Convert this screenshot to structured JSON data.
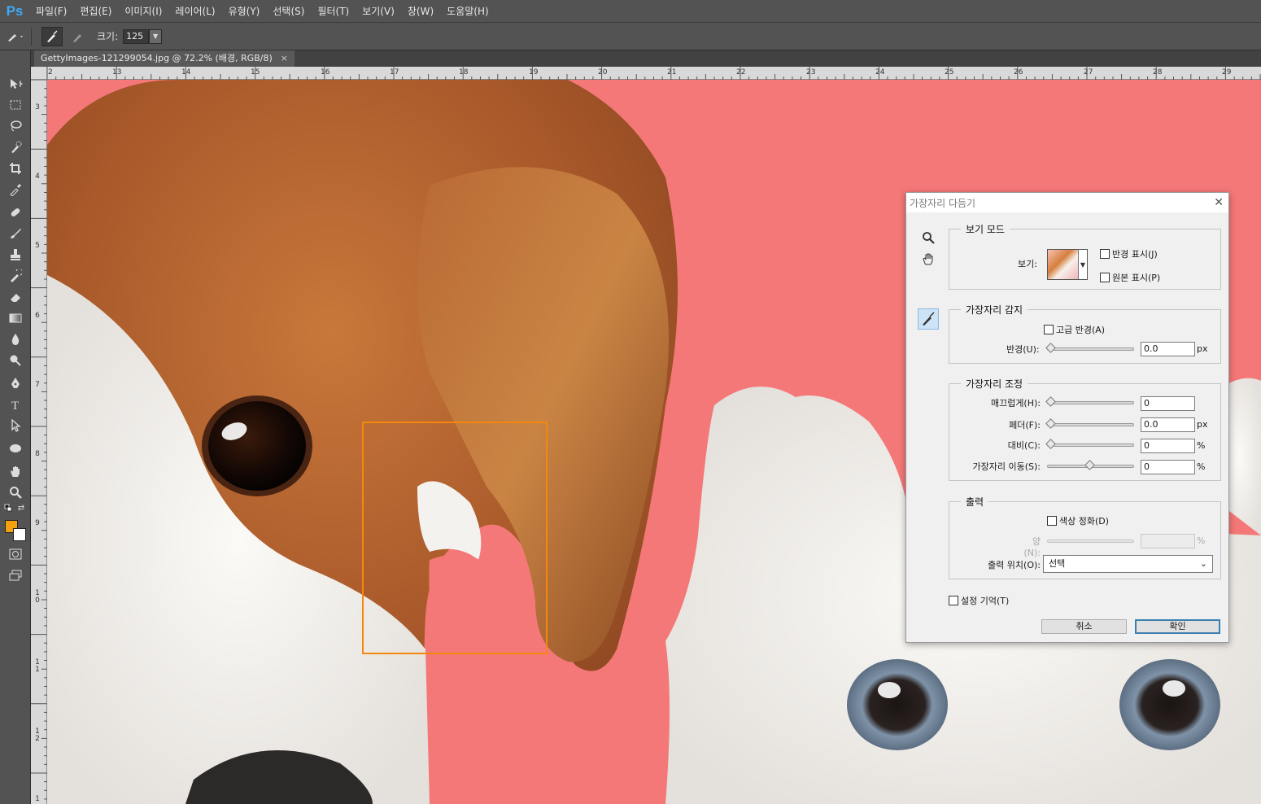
{
  "app": {
    "logo": "Ps"
  },
  "menu": [
    "파일(F)",
    "편집(E)",
    "이미지(I)",
    "레이어(L)",
    "유형(Y)",
    "선택(S)",
    "필터(T)",
    "보기(V)",
    "창(W)",
    "도움말(H)"
  ],
  "options": {
    "size_label": "크기:",
    "size_value": "125"
  },
  "tab": {
    "title": "GettyImages-121299054.jpg @ 72.2% (배경, RGB/8)",
    "close": "×"
  },
  "ruler_top": [
    "2",
    "13",
    "14",
    "15",
    "16",
    "17",
    "18",
    "19",
    "20",
    "21",
    "22",
    "23",
    "24",
    "25",
    "26",
    "27",
    "28",
    "29"
  ],
  "ruler_left": [
    "3",
    "4",
    "5",
    "6",
    "7",
    "8",
    "9",
    "10",
    "11",
    "12",
    "1"
  ],
  "colors": {
    "foreground": "#f5a00e",
    "background": "#ffffff",
    "canvas_bg": "#f57878",
    "selection": "#f5870e"
  },
  "dialog": {
    "title": "가장자리 다듬기",
    "close": "✕",
    "view_mode": {
      "group": "보기 모드",
      "view_label": "보기:",
      "show_radius": "반경 표시(J)",
      "show_original": "원본 표시(P)"
    },
    "edge_detection": {
      "group": "가장자리 감지",
      "smart_radius": "고급 반경(A)",
      "radius_label": "반경(U):",
      "radius_value": "0.0",
      "radius_unit": "px",
      "radius_level": 0
    },
    "adjust_edge": {
      "group": "가장자리 조정",
      "smooth_label": "매끄럽게(H):",
      "smooth_value": "0",
      "smooth_level": 0,
      "feather_label": "페더(F):",
      "feather_value": "0.0",
      "feather_unit": "px",
      "feather_level": 0,
      "contrast_label": "대비(C):",
      "contrast_value": "0",
      "contrast_unit": "%",
      "contrast_level": 0,
      "shift_label": "가장자리 이동(S):",
      "shift_value": "0",
      "shift_unit": "%",
      "shift_level": 0.5
    },
    "output": {
      "group": "출력",
      "decontaminate": "색상 정화(D)",
      "amount_label": "양(N):",
      "amount_value": "",
      "amount_unit": "%",
      "output_to_label": "출력 위치(O):",
      "output_to_value": "선택"
    },
    "remember": "설정 기억(T)",
    "cancel": "취소",
    "ok": "확인"
  }
}
